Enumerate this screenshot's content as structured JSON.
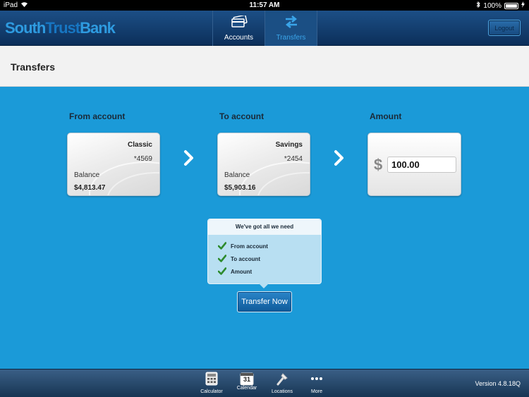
{
  "status_bar": {
    "device": "iPad",
    "time": "11:57 AM",
    "battery": "100%"
  },
  "header": {
    "logo": {
      "part1": "South",
      "part2": "Trust",
      "part3": "Bank"
    },
    "tabs": [
      {
        "label": "Accounts",
        "icon": "cards-icon",
        "active": false
      },
      {
        "label": "Transfers",
        "icon": "transfer-arrows-icon",
        "active": true
      }
    ],
    "logout_label": "Logout"
  },
  "page": {
    "title": "Transfers"
  },
  "transfer": {
    "from_label": "From account",
    "to_label": "To account",
    "amount_label": "Amount",
    "from_card": {
      "name": "Classic",
      "number": "*4569",
      "balance_label": "Balance",
      "balance": "$4,813.47"
    },
    "to_card": {
      "name": "Savings",
      "number": "*2454",
      "balance_label": "Balance",
      "balance": "$5,903.16"
    },
    "currency_symbol": "$",
    "amount_value": "100.00"
  },
  "checklist": {
    "title": "We've got all we need",
    "items": [
      "From account",
      "To account",
      "Amount"
    ]
  },
  "transfer_button_label": "Transfer Now",
  "toolbar": {
    "items": [
      {
        "label": "Calculator",
        "icon": "calculator-icon"
      },
      {
        "label": "Calendar",
        "icon": "calendar-icon",
        "day": "31"
      },
      {
        "label": "Locations",
        "icon": "location-pin-icon"
      },
      {
        "label": "More",
        "icon": "more-dots-icon"
      }
    ],
    "version": "Version 4.8.18Q"
  },
  "colors": {
    "background": "#1b9ad8",
    "navbar": "#0c2f5a",
    "active_tab_text": "#3aa5e9",
    "check_green": "#2e8b2e"
  }
}
